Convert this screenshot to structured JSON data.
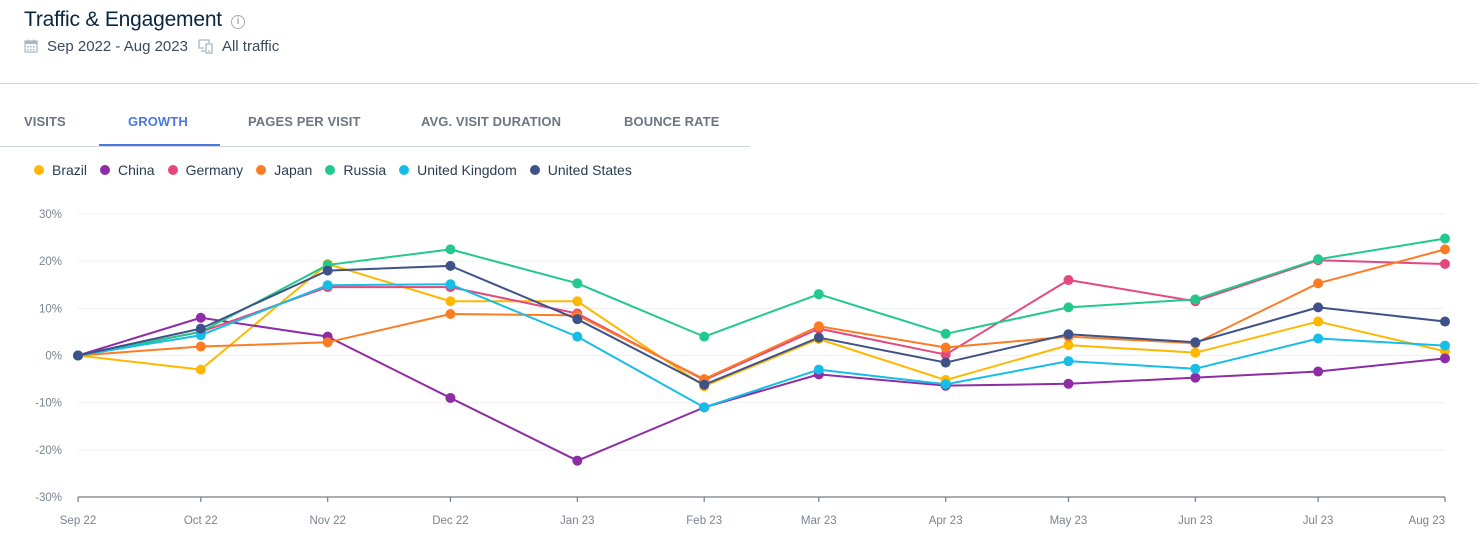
{
  "header": {
    "title": "Traffic & Engagement",
    "info_icon": "info-icon",
    "date_range": "Sep 2022 - Aug 2023",
    "date_icon": "calendar-icon",
    "traffic_type": "All traffic",
    "traffic_icon": "devices-icon"
  },
  "tabs": [
    {
      "label": "VISITS",
      "active": false
    },
    {
      "label": "GROWTH",
      "active": true
    },
    {
      "label": "PAGES PER VISIT",
      "active": false
    },
    {
      "label": "AVG. VISIT DURATION",
      "active": false
    },
    {
      "label": "BOUNCE RATE",
      "active": false
    }
  ],
  "chart_data": {
    "type": "line",
    "title": "",
    "xlabel": "",
    "ylabel": "",
    "x": [
      "Sep 22",
      "Oct 22",
      "Nov 22",
      "Dec 22",
      "Jan 23",
      "Feb 23",
      "Mar 23",
      "Apr 23",
      "May 23",
      "Jun 23",
      "Jul 23",
      "Aug 23"
    ],
    "x_days": [
      0,
      30,
      61,
      91,
      122,
      153,
      181,
      212,
      242,
      273,
      303,
      334
    ],
    "ylim": [
      -30,
      30
    ],
    "yticks": [
      30,
      20,
      10,
      0,
      -10,
      -20,
      -30
    ],
    "ytick_labels": [
      "30%",
      "20%",
      "10%",
      "0%",
      "-10%",
      "-20%",
      "-30%"
    ],
    "grid": true,
    "legend_position": "top-left",
    "series": [
      {
        "name": "Brazil",
        "color": "#ffb800",
        "values": [
          0,
          -3.0,
          19.4,
          11.5,
          11.5,
          -6.5,
          3.5,
          -5.2,
          2.2,
          0.6,
          7.2,
          0.9
        ]
      },
      {
        "name": "China",
        "color": "#8e2ca6",
        "values": [
          0,
          8.0,
          4.0,
          -9.0,
          -22.3,
          -11.0,
          -4.0,
          -6.4,
          -6.0,
          -4.7,
          -3.4,
          -0.6
        ]
      },
      {
        "name": "Germany",
        "color": "#e5487d",
        "values": [
          0,
          5.0,
          14.5,
          14.5,
          8.9,
          -5.2,
          5.7,
          0.2,
          16.0,
          11.5,
          20.2,
          19.4
        ]
      },
      {
        "name": "Japan",
        "color": "#fc7c24",
        "values": [
          0,
          1.9,
          2.8,
          8.8,
          8.5,
          -5.0,
          6.2,
          1.7,
          4.0,
          2.6,
          15.3,
          22.5
        ]
      },
      {
        "name": "Russia",
        "color": "#23c88c",
        "values": [
          0,
          5.0,
          19.2,
          22.5,
          15.3,
          4.0,
          13.0,
          4.6,
          10.2,
          11.9,
          20.4,
          24.8
        ]
      },
      {
        "name": "United Kingdom",
        "color": "#16bde6",
        "values": [
          0,
          4.3,
          14.9,
          15.1,
          4.0,
          -11.0,
          -3.0,
          -6.1,
          -1.2,
          -2.8,
          3.6,
          2.1
        ]
      },
      {
        "name": "United States",
        "color": "#3e5289",
        "values": [
          0,
          5.7,
          18.0,
          19.0,
          7.7,
          -6.2,
          3.8,
          -1.5,
          4.5,
          2.8,
          10.2,
          7.2
        ]
      }
    ]
  }
}
